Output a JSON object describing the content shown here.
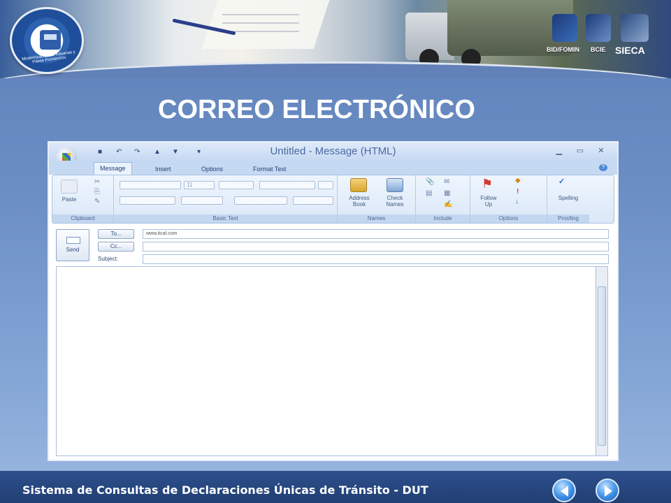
{
  "header": {
    "logo_ring_text": "Modernización de Aduanas y Pasos Fronterizos",
    "partners": [
      "BID/FOMIN",
      "BCIE",
      "SIECA"
    ]
  },
  "slide": {
    "title": "CORREO ELECTRÓNICO",
    "footer": "Sistema de Consultas de Declaraciones Únicas de Tránsito - DUT"
  },
  "outlook": {
    "window_title": "Untitled - Message (HTML)",
    "tabs": [
      "Message",
      "Insert",
      "Options",
      "Format Text"
    ],
    "groups": {
      "clipboard": "Clipboard",
      "basic_text": "Basic Text",
      "names": "Names",
      "include": "Include",
      "options": "Options",
      "proofing": "Proofing"
    },
    "buttons": {
      "paste": "Paste",
      "font_size": "11",
      "address_book_1": "Address",
      "address_book_2": "Book",
      "check_names_1": "Check",
      "check_names_2": "Names",
      "follow_up_1": "Follow",
      "follow_up_2": "Up",
      "spelling": "Spelling",
      "send": "Send",
      "to": "To...",
      "cc": "Cc..."
    },
    "fields": {
      "subject_label": "Subject:",
      "to_value": "www.itcal.com",
      "cc_value": "",
      "subject_value": ""
    }
  },
  "nav": {
    "prev": "previous-slide",
    "next": "next-slide"
  },
  "colors": {
    "footer": "#213f73",
    "ribbon": "#dbe8f8",
    "accent": "#3d8fe6"
  }
}
